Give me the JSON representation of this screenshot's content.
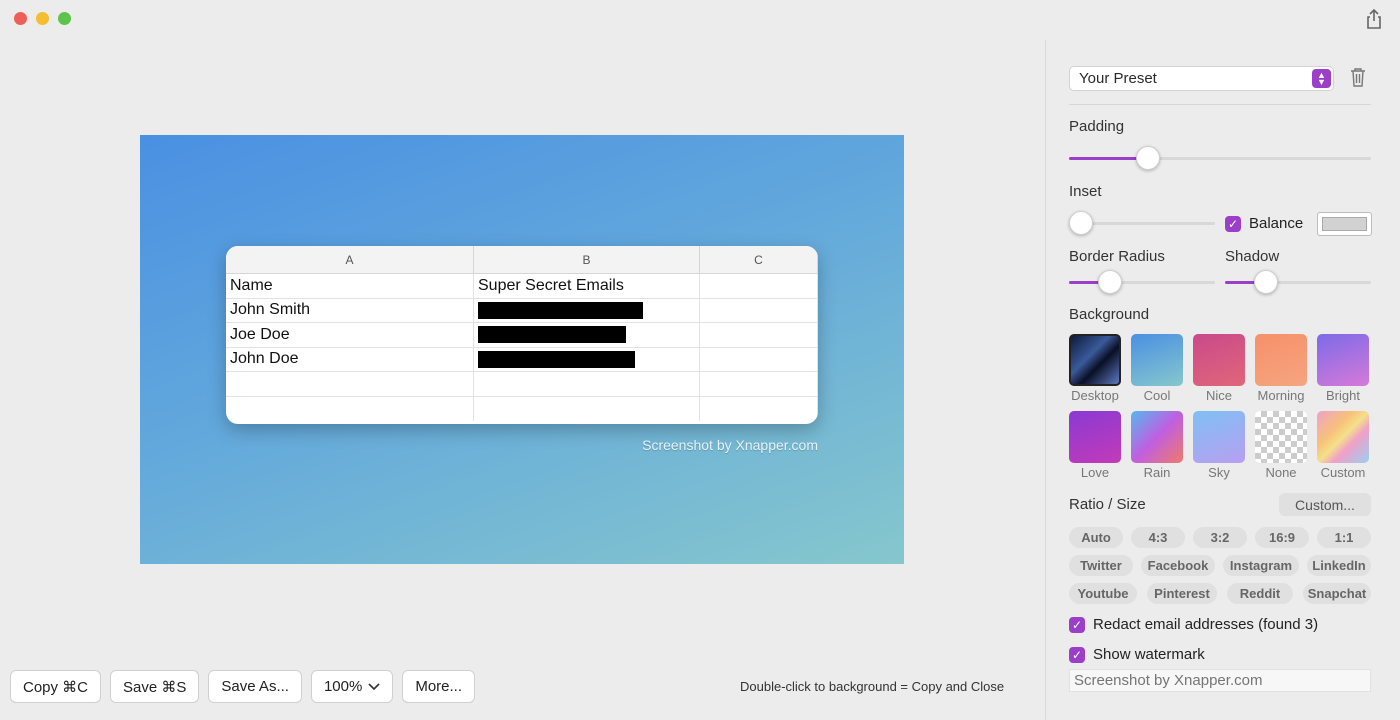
{
  "toolbar": {
    "share_icon": "share-icon"
  },
  "sheet": {
    "columns": [
      "A",
      "B",
      "C"
    ],
    "rows": [
      {
        "a": "Name",
        "b": "Super Secret Emails"
      },
      {
        "a": "John Smith",
        "b": ""
      },
      {
        "a": "Joe Doe",
        "b": ""
      },
      {
        "a": "John Doe",
        "b": ""
      }
    ]
  },
  "canvas": {
    "watermark": "Screenshot by Xnapper.com"
  },
  "bottom": {
    "copy": "Copy ⌘C",
    "save": "Save ⌘S",
    "save_as": "Save As...",
    "zoom": "100%",
    "more": "More...",
    "hint": "Double-click to background = Copy and Close"
  },
  "sidebar": {
    "preset": "Your Preset",
    "padding_label": "Padding",
    "padding_value": 0.26,
    "inset_label": "Inset",
    "inset_value": 0.0,
    "balance_label": "Balance",
    "border_radius_label": "Border Radius",
    "border_radius_value": 0.28,
    "shadow_label": "Shadow",
    "shadow_value": 0.28,
    "background_label": "Background",
    "backgrounds": [
      "Desktop",
      "Cool",
      "Nice",
      "Morning",
      "Bright",
      "Love",
      "Rain",
      "Sky",
      "None",
      "Custom"
    ],
    "ratio_label": "Ratio / Size",
    "custom_button": "Custom...",
    "ratios": [
      "Auto",
      "4:3",
      "3:2",
      "16:9",
      "1:1"
    ],
    "platforms_1": [
      "Twitter",
      "Facebook",
      "Instagram",
      "LinkedIn"
    ],
    "platforms_2": [
      "Youtube",
      "Pinterest",
      "Reddit",
      "Snapchat"
    ],
    "redact_label": "Redact email addresses (found 3)",
    "watermark_label": "Show watermark",
    "watermark_text": "Screenshot by Xnapper.com"
  },
  "colors": {
    "accent": "#9b3fc9",
    "canvas_start": "#4a90e2",
    "canvas_end": "#86c7cd"
  }
}
